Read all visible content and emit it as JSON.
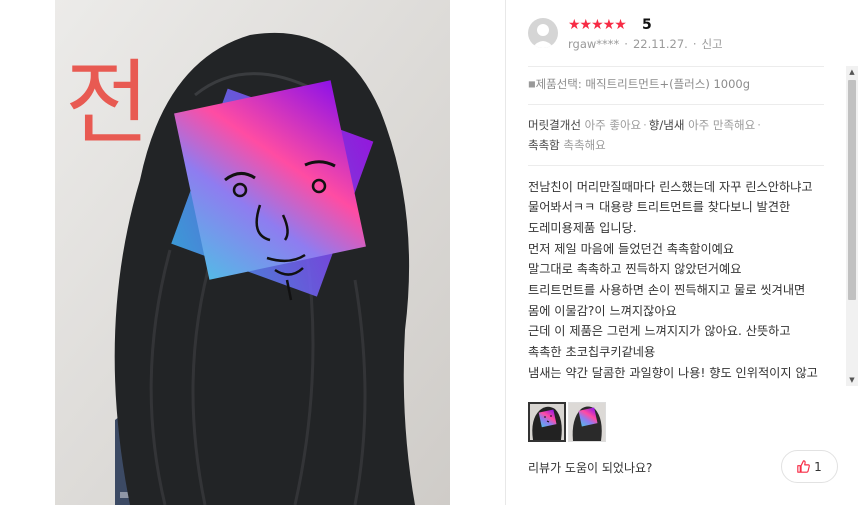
{
  "photo": {
    "handwritten_text": "전"
  },
  "review": {
    "stars": "★★★★★",
    "score": "5",
    "username": "rgaw****",
    "date": "22.11.27.",
    "report_label": "신고",
    "product_option": "제품선택: 매직트리트먼트+(플러스) 1000g",
    "evaluations": [
      {
        "key": "머릿결개선",
        "value": "아주 좋아요"
      },
      {
        "key": "향/냄새",
        "value": "아주 만족해요"
      },
      {
        "key": "촉촉함",
        "value": "촉촉해요"
      }
    ],
    "body": "전남친이 머리만질때마다 린스했는데 자꾸 린스안하냐고 물어봐서ㅋㅋ 대용량 트리트먼트를 찾다보니 발견한 도레미용제품 입니당.\n먼저 제일 마음에 들었던건 촉촉함이예요\n말그대로 촉촉하고 찐득하지 않았던거예요\n트리트먼트를 사용하면 손이 찐득해지고 물로 씻겨내면 몸에 이물감?이 느껴지잖아요\n근데 이 제품은 그런게 느껴지지가 않아요. 산뜻하고 촉촉한 초코칩쿠키같네용\n냄새는 약간 달콤한 과일향이 나용! 향도 인위적이지 않고 너 좋아요. 사이하고 시워다니 재 몸에서 과이향"
  },
  "footer": {
    "helpful_question": "리뷰가 도움이 되었나요?",
    "like_count": "1"
  },
  "colors": {
    "star": "#f72b45",
    "like_icon": "#f72b45"
  }
}
